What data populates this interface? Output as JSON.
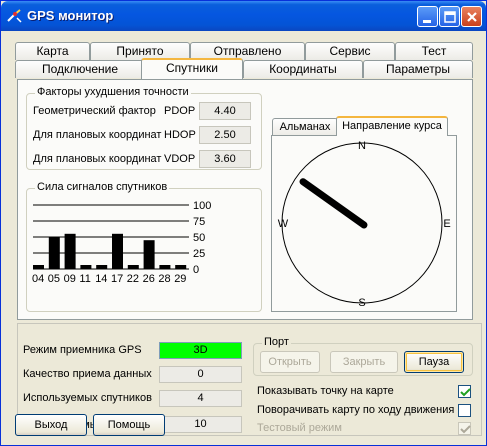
{
  "window": {
    "title": "GPS монитор",
    "icon": "satellite-icon",
    "controls": {
      "minimize": "minimize-icon",
      "maximize": "maximize-icon",
      "close": "close-icon"
    }
  },
  "tabs": {
    "row_top": [
      "Карта",
      "Принято",
      "Отправлено",
      "Сервис",
      "Тест"
    ],
    "row_bottom": [
      "Подключение",
      "Спутники",
      "Координаты",
      "Параметры"
    ],
    "active": "Спутники"
  },
  "dop": {
    "title": "Факторы ухудшения точности",
    "rows": [
      {
        "label": "Геометрический фактор",
        "key": "PDOP",
        "value": "4.40"
      },
      {
        "label": "Для плановых координат",
        "key": "HDOP",
        "value": "2.50"
      },
      {
        "label": "Для плановых координат",
        "key": "VDOP",
        "value": "3.60"
      }
    ]
  },
  "signal": {
    "title": "Сила сигналов спутников",
    "y_ticks": [
      "100",
      "75",
      "50",
      "25",
      "0"
    ],
    "satellites": [
      "04",
      "05",
      "09",
      "11",
      "14",
      "17",
      "22",
      "26",
      "28",
      "29"
    ],
    "levels": [
      5,
      50,
      55,
      5,
      5,
      55,
      5,
      45,
      5,
      5
    ]
  },
  "compass": {
    "tabs": [
      "Альманах",
      "Направление курса"
    ],
    "active_tab": "Направление курса",
    "directions": {
      "n": "N",
      "s": "S",
      "e": "E",
      "w": "W"
    },
    "heading_deg": 305
  },
  "status": {
    "receiver_mode_label": "Режим приемника GPS",
    "receiver_mode_value": "3D",
    "receiver_mode_color": "#00ff00",
    "quality_label": "Качество приема данных",
    "quality_value": "0",
    "used_sats_label": "Используемых спутников",
    "used_sats_value": "4",
    "visible_sats_label": "Число видимых спутников",
    "visible_sats_value": "10"
  },
  "port": {
    "title": "Порт",
    "open_label": "Открыть",
    "close_label": "Закрыть",
    "pause_label": "Пауза"
  },
  "options": {
    "show_point_label": "Показывать точку на карте",
    "show_point_checked": true,
    "rotate_map_label": "Поворачивать карту по ходу движения",
    "rotate_map_checked": false,
    "test_mode_label": "Тестовый режим",
    "test_mode_checked": true
  },
  "footer": {
    "exit_label": "Выход",
    "help_label": "Помощь"
  },
  "colors": {
    "title_bar": "#0556e0",
    "accent_tab": "#f4b63f",
    "bar_color": "#000000"
  }
}
